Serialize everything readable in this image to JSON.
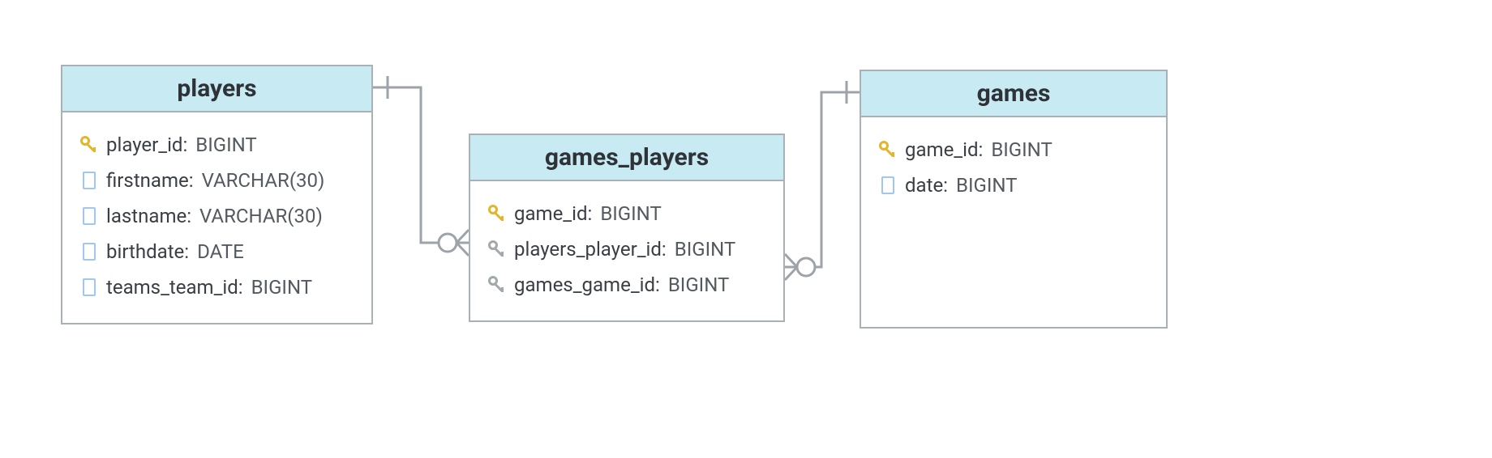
{
  "diagram": {
    "tables": {
      "players": {
        "title": "players",
        "columns": [
          {
            "icon": "pk",
            "name": "player_id:",
            "type": "BIGINT"
          },
          {
            "icon": "col",
            "name": "firstname:",
            "type": "VARCHAR(30)"
          },
          {
            "icon": "col",
            "name": "lastname:",
            "type": "VARCHAR(30)"
          },
          {
            "icon": "col",
            "name": "birthdate:",
            "type": "DATE"
          },
          {
            "icon": "col",
            "name": "teams_team_id:",
            "type": "BIGINT"
          }
        ]
      },
      "games_players": {
        "title": "games_players",
        "columns": [
          {
            "icon": "pk",
            "name": "game_id:",
            "type": "BIGINT"
          },
          {
            "icon": "fk",
            "name": "players_player_id:",
            "type": "BIGINT"
          },
          {
            "icon": "fk",
            "name": "games_game_id:",
            "type": "BIGINT"
          }
        ]
      },
      "games": {
        "title": "games",
        "columns": [
          {
            "icon": "pk",
            "name": "game_id:",
            "type": "BIGINT"
          },
          {
            "icon": "col",
            "name": "date:",
            "type": "BIGINT"
          }
        ]
      }
    },
    "relationships": [
      {
        "from": "players",
        "to": "games_players",
        "from_cardinality": "one",
        "to_cardinality": "zero-or-many"
      },
      {
        "from": "games",
        "to": "games_players",
        "from_cardinality": "one",
        "to_cardinality": "zero-or-many"
      }
    ],
    "style": {
      "header_bg": "#c7eaf3",
      "border": "#a9b0b6",
      "line": "#9da3a9",
      "pk_color": "#e3b52a",
      "fk_color": "#a3a8ad",
      "col_color": "#9fc7ef"
    }
  }
}
